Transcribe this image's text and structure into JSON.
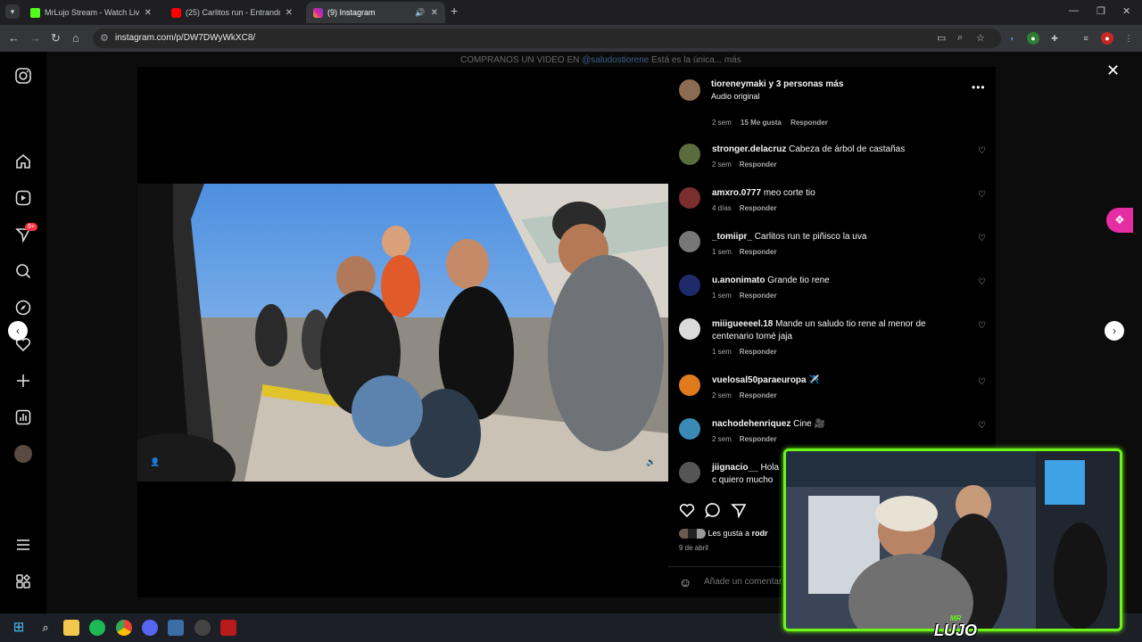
{
  "browser": {
    "tabs": [
      {
        "label": "MrLujo Stream - Watch Live on",
        "icon_color": "#53fc18",
        "icon": "kick-icon",
        "active": false
      },
      {
        "label": "(25) Carlitos run - Entrando pa",
        "icon_color": "#ff0000",
        "icon": "youtube-icon",
        "active": false
      },
      {
        "label": "(9) Instagram",
        "icon_color": "#d6249f",
        "icon": "instagram-icon",
        "active": true
      }
    ],
    "url": "instagram.com/p/DW7DWyWkXC8/"
  },
  "instagram": {
    "background_caption": {
      "text": "COMPRANOS UN VIDEO EN",
      "mention": "@saludostiorene",
      "rest": "Está es la única...",
      "more": "más"
    },
    "notifications_badge": "9+",
    "post": {
      "author": "tioreneymaki y 3 personas más",
      "audio": "Audio original"
    },
    "first_meta": {
      "time": "2 sem",
      "likes": "15 Me gusta",
      "reply": "Responder"
    },
    "comments": [
      {
        "user": "stronger.delacruz",
        "text": "Cabeza de árbol de castañas",
        "time": "2 sem",
        "reply": "Responder",
        "avatar_color": "#5a6b3c"
      },
      {
        "user": "amxro.0777",
        "text": "meo corte tio",
        "time": "4 días",
        "reply": "Responder",
        "avatar_color": "#7a2e2e"
      },
      {
        "user": "_tomiipr_",
        "text": "Carlitos run te piñisco la uva",
        "time": "1 sem",
        "reply": "Responder",
        "avatar_color": "#777777"
      },
      {
        "user": "u.anonimato",
        "text": "Grande tio rene",
        "time": "1 sem",
        "reply": "Responder",
        "avatar_color": "#1f2a6b"
      },
      {
        "user": "miiigueeeel.18",
        "text": "Mande un saludo tio rene al menor de centenario tomé jaja",
        "time": "1 sem",
        "reply": "Responder",
        "avatar_color": "#dbdbdb"
      },
      {
        "user": "vuelosal50paraeuropa",
        "text": "✈️",
        "time": "2 sem",
        "reply": "Responder",
        "avatar_color": "#e07a1f"
      },
      {
        "user": "nachodehenriquez",
        "text": "Cine 🎥",
        "time": "2 sem",
        "reply": "Responder",
        "avatar_color": "#3b8ab5"
      },
      {
        "user": "jiignacio__",
        "text": "Hola c quiero mucho",
        "time": "",
        "reply": "",
        "avatar_color": "#555555"
      }
    ],
    "likes_text": "Les gusta a",
    "likes_user": "rodr",
    "date": "9 de abril",
    "add_comment_placeholder": "Añade un comentar"
  },
  "webcam": {
    "logo_top": "MR",
    "logo_bottom": "LUJO"
  }
}
